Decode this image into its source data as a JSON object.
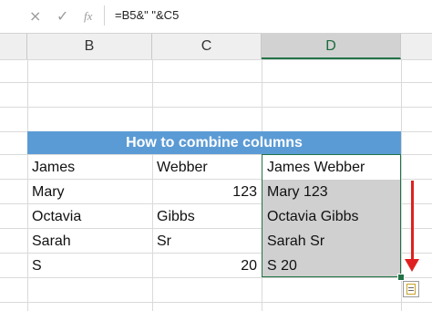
{
  "formula_bar": {
    "cancel_icon": "×",
    "enter_icon": "✓",
    "fx_icon": "fx",
    "formula": "=B5&\" \"&C5"
  },
  "columns": [
    {
      "label": "B",
      "selected": false
    },
    {
      "label": "C",
      "selected": false
    },
    {
      "label": "D",
      "selected": true
    }
  ],
  "banner": {
    "title": "How to combine columns"
  },
  "rows": [
    {
      "b": "James",
      "c": "Webber",
      "c_numeric": false,
      "d": "James  Webber"
    },
    {
      "b": "Mary",
      "c": "123",
      "c_numeric": true,
      "d": "Mary  123"
    },
    {
      "b": "Octavia",
      "c": "Gibbs",
      "c_numeric": false,
      "d": "Octavia Gibbs"
    },
    {
      "b": "Sarah",
      "c": "Sr",
      "c_numeric": false,
      "d": "Sarah Sr"
    },
    {
      "b": "S",
      "c": "20",
      "c_numeric": true,
      "d": "S 20"
    }
  ],
  "colors": {
    "banner": "#5b9bd5",
    "selection": "#217346",
    "selection_fill": "#d0d0d0",
    "arrow": "#e02020"
  },
  "icons": {
    "quick_analysis": "quick-analysis-icon",
    "arrow": "red-down-arrow-icon"
  }
}
